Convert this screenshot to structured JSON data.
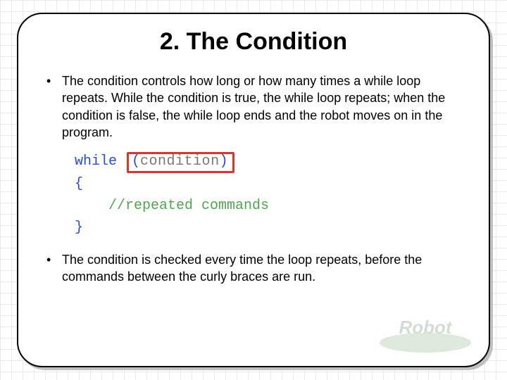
{
  "title": "2. The Condition",
  "bullets": [
    "The condition controls how long or how many times a while loop repeats. While the condition is true, the while loop repeats; when the condition is false, the while loop ends and the robot moves on in the program.",
    "The condition is checked every time the loop repeats, before the commands between the curly braces are run."
  ],
  "code": {
    "keyword": "while",
    "lparen": "(",
    "condition": "condition",
    "rparen": ")",
    "open_brace": "{",
    "comment": "//repeated commands",
    "close_brace": "}"
  },
  "watermark_text": "Robot"
}
